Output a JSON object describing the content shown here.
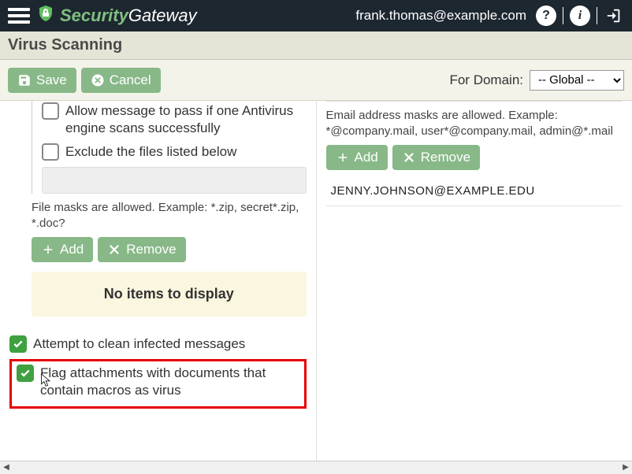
{
  "header": {
    "logo_security": "Security",
    "logo_gateway": "Gateway",
    "user_email": "frank.thomas@example.com"
  },
  "subtitle": "Virus Scanning",
  "actionbar": {
    "save": "Save",
    "cancel": "Cancel",
    "for_domain_label": "For Domain:",
    "domain_selected": "-- Global --"
  },
  "left": {
    "truncated_line": "",
    "opt_allow_pass": "Allow message to pass if one Antivirus engine scans successfully",
    "opt_exclude_files": "Exclude the files listed below",
    "file_masks_hint": "File masks are allowed. Example: *.zip, secret*.zip, *.doc?",
    "add": "Add",
    "remove": "Remove",
    "no_items": "No items to display",
    "opt_attempt_clean": "Attempt to clean infected messages",
    "opt_flag_macros": "Flag attachments with documents that contain macros as virus"
  },
  "right": {
    "email_masks_hint": "Email address masks are allowed. Example: *@company.mail, user*@company.mail, admin@*.mail",
    "add": "Add",
    "remove": "Remove",
    "emails": [
      "JENNY.JOHNSON@EXAMPLE.EDU"
    ]
  }
}
